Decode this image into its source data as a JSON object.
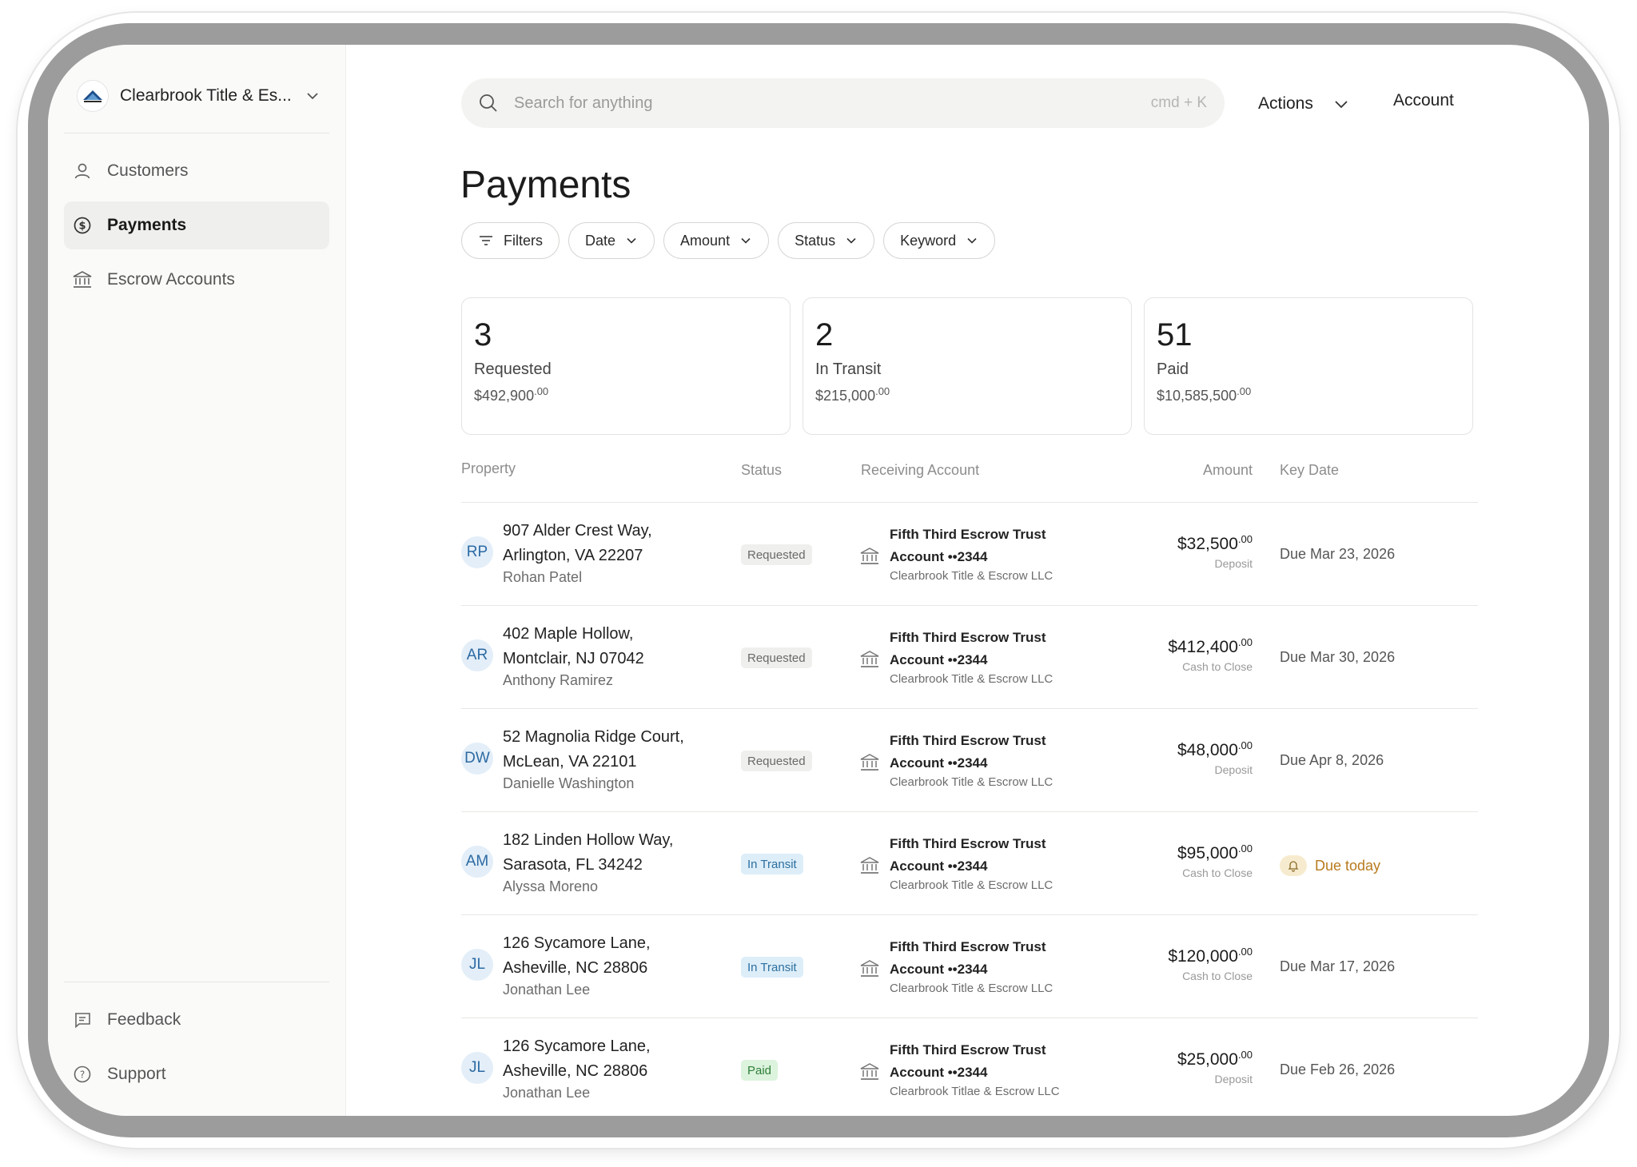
{
  "org": {
    "name": "Clearbrook Title & Es..."
  },
  "nav": {
    "items": [
      {
        "label": "Customers"
      },
      {
        "label": "Payments"
      },
      {
        "label": "Escrow Accounts"
      }
    ],
    "footer": [
      {
        "label": "Feedback"
      },
      {
        "label": "Support"
      }
    ]
  },
  "search": {
    "placeholder": "Search for anything",
    "shortcut": "cmd + K"
  },
  "header": {
    "actions_label": "Actions",
    "account_label": "Account"
  },
  "page": {
    "title": "Payments"
  },
  "filters": [
    "Filters",
    "Date",
    "Amount",
    "Status",
    "Keyword"
  ],
  "summary": [
    {
      "count": "3",
      "label": "Requested",
      "amount": "$492,900",
      "cents": ".00"
    },
    {
      "count": "2",
      "label": "In Transit",
      "amount": "$215,000",
      "cents": ".00"
    },
    {
      "count": "51",
      "label": "Paid",
      "amount": "$10,585,500",
      "cents": ".00"
    }
  ],
  "table": {
    "columns": [
      "Property",
      "Status",
      "Receiving Account",
      "Amount",
      "Key Date"
    ],
    "rows": [
      {
        "initials": "RP",
        "address1": "907 Alder Crest Way,",
        "address2": "Arlington, VA 22207",
        "person": "Rohan Patel",
        "status": "Requested",
        "bank1": "Fifth Third Escrow Trust",
        "bank2": "Account ••2344",
        "bank3": "Clearbrook Title & Escrow LLC",
        "amount": "$32,500",
        "cents": ".00",
        "type": "Deposit",
        "key_date": "Due Mar 23, 2026"
      },
      {
        "initials": "AR",
        "address1": "402 Maple Hollow,",
        "address2": "Montclair, NJ 07042",
        "person": "Anthony Ramirez",
        "status": "Requested",
        "bank1": "Fifth Third Escrow Trust",
        "bank2": "Account ••2344",
        "bank3": "Clearbrook Title & Escrow LLC",
        "amount": "$412,400",
        "cents": ".00",
        "type": "Cash to Close",
        "key_date": "Due Mar 30, 2026"
      },
      {
        "initials": "DW",
        "address1": "52 Magnolia Ridge Court,",
        "address2": "McLean, VA 22101",
        "person": "Danielle Washington",
        "status": "Requested",
        "bank1": "Fifth Third Escrow Trust",
        "bank2": "Account ••2344",
        "bank3": "Clearbrook Title & Escrow LLC",
        "amount": "$48,000",
        "cents": ".00",
        "type": "Deposit",
        "key_date": "Due Apr 8, 2026"
      },
      {
        "initials": "AM",
        "address1": "182 Linden Hollow Way,",
        "address2": "Sarasota, FL 34242",
        "person": "Alyssa Moreno",
        "status": "In Transit",
        "bank1": "Fifth Third Escrow Trust",
        "bank2": "Account ••2344",
        "bank3": "Clearbrook Title & Escrow LLC",
        "amount": "$95,000",
        "cents": ".00",
        "type": "Cash to Close",
        "key_date": "Due today"
      },
      {
        "initials": "JL",
        "address1": "126 Sycamore Lane,",
        "address2": "Asheville, NC 28806",
        "person": "Jonathan Lee",
        "status": "In Transit",
        "bank1": "Fifth Third Escrow Trust",
        "bank2": "Account ••2344",
        "bank3": "Clearbrook Title & Escrow LLC",
        "amount": "$120,000",
        "cents": ".00",
        "type": "Cash to Close",
        "key_date": "Due Mar 17, 2026"
      },
      {
        "initials": "JL",
        "address1": "126 Sycamore Lane,",
        "address2": "Asheville, NC 28806",
        "person": "Jonathan Lee",
        "status": "Paid",
        "bank1": "Fifth Third Escrow Trust",
        "bank2": "Account ••2344",
        "bank3": "Clearbrook Titlae & Escrow LLC",
        "amount": "$25,000",
        "cents": ".00",
        "type": "Deposit",
        "key_date": "Due Feb 26, 2026"
      }
    ]
  },
  "colors": {
    "transit_badge": "#ddeef9",
    "paid_badge": "#dcf3dd",
    "due_today": "#b87a1e",
    "bezel": "#9c9c9c"
  }
}
